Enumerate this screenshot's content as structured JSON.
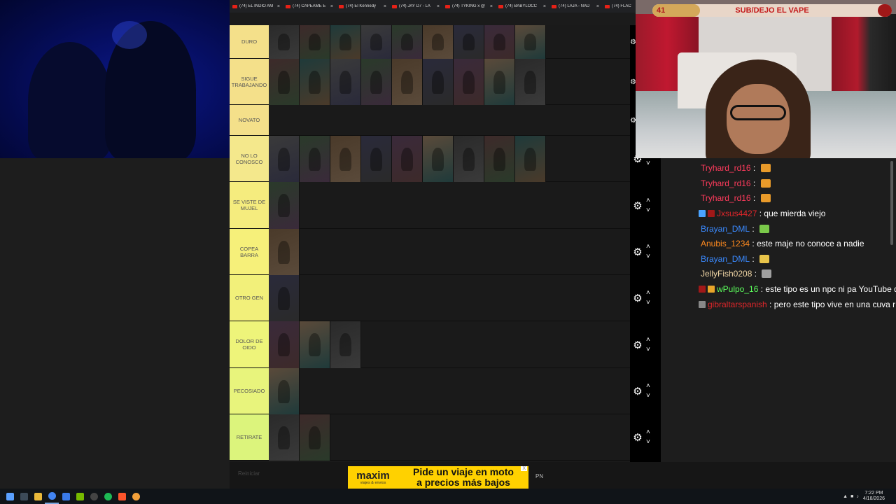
{
  "browser_tabs": [
    {
      "label": "(74) EL INDIO AM"
    },
    {
      "label": "(74) CAPEAME E"
    },
    {
      "label": "(74) El Kennedy"
    },
    {
      "label": "(74) JAY D7 - LA"
    },
    {
      "label": "(74) TYKING x @"
    },
    {
      "label": "(74) BABYLOCC"
    },
    {
      "label": "(74) LAJA - NAD"
    },
    {
      "label": "(74) FLAC"
    }
  ],
  "tiers": [
    {
      "label": "DURO",
      "color": "#f4e08a",
      "count": 9
    },
    {
      "label": "SIGUE TRABAJANDO",
      "color": "#f4e08a",
      "count": 9
    },
    {
      "label": "NOVATO",
      "color": "#f4e08a",
      "count": 0
    },
    {
      "label": "NO LO CONOSCO",
      "color": "#f4e88c",
      "count": 9
    },
    {
      "label": "SE VISTE DE MUJEL",
      "color": "#f5ec7e",
      "count": 1
    },
    {
      "label": "COPEA BARRA",
      "color": "#f6f07a",
      "count": 1
    },
    {
      "label": "OTRO GEN",
      "color": "#f2f07a",
      "count": 1
    },
    {
      "label": "DOLOR DE OIDO",
      "color": "#eef47a",
      "count": 3
    },
    {
      "label": "PECOSIADO",
      "color": "#e8f47c",
      "count": 1
    },
    {
      "label": "RETIRATE",
      "color": "#dcf47c",
      "count": 2
    }
  ],
  "goal": {
    "count": "41",
    "text": "SUB/DEJO EL VAPE",
    "progress": 0.2
  },
  "chat": [
    {
      "user": "Tryhard_rd16",
      "color": "#ff3b5c",
      "text": "",
      "emote": "#e89a2a",
      "badges": []
    },
    {
      "user": "Tryhard_rd16",
      "color": "#ff3b5c",
      "text": "",
      "emote": "#e89a2a",
      "badges": []
    },
    {
      "user": "Tryhard_rd16",
      "color": "#ff3b5c",
      "text": "",
      "emote": "#e89a2a",
      "badges": []
    },
    {
      "user": "Jxsus4427",
      "color": "#e0262a",
      "text": "que mierda viejo",
      "emote": "",
      "badges": [
        "#4aa3ff",
        "#a01818"
      ]
    },
    {
      "user": "Brayan_DML",
      "color": "#3a8aff",
      "text": "",
      "emote": "#7ac94a",
      "badges": []
    },
    {
      "user": "Anubis_1234",
      "color": "#ff8a1f",
      "text": "este maje no conoce a nadie",
      "emote": "",
      "badges": []
    },
    {
      "user": "Brayan_DML",
      "color": "#3a8aff",
      "text": "",
      "emote": "#e8c44a",
      "badges": []
    },
    {
      "user": "JellyFish0208",
      "color": "#f2d7a6",
      "text": "",
      "emote": "#a0a0a0",
      "badges": []
    },
    {
      "user": "wPulpo_16",
      "color": "#5cff5c",
      "text": "este tipo es un npc ni pa YouTube d",
      "emote": "",
      "badges": [
        "#a01818",
        "#e8a52a"
      ]
    },
    {
      "user": "gibraltarspanish",
      "color": "#e0262a",
      "text": "pero este tipo vive en una cuva r",
      "emote": "",
      "badges": [
        "#888888"
      ]
    }
  ],
  "ad": {
    "brand": "maxim",
    "sub": "viajes & envios",
    "line1": "Pide un viaje en moto",
    "line2": "a precios más bajos",
    "close": "X"
  },
  "pn_label": "PN",
  "footer_label": "Reiniciar",
  "tray": {
    "time": "7:22 PM",
    "date": "4/18/2026"
  }
}
